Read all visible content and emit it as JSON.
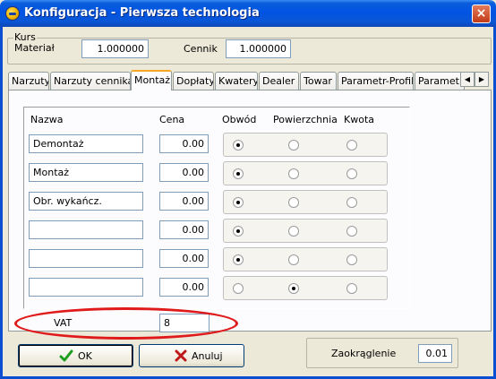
{
  "window": {
    "title": "Konfiguracja - Pierwsza technologia",
    "close_glyph": "×"
  },
  "kurs": {
    "legend": "Kurs",
    "material_label": "Materiał",
    "material_value": "1.000000",
    "cennik_label": "Cennik",
    "cennik_value": "1.000000"
  },
  "tabs": [
    {
      "label": "Narzuty"
    },
    {
      "label": "Narzuty cennika"
    },
    {
      "label": "Montaż"
    },
    {
      "label": "Dopłaty"
    },
    {
      "label": "Kwatery"
    },
    {
      "label": "Dealer"
    },
    {
      "label": "Towar"
    },
    {
      "label": "Parametr-Profile"
    },
    {
      "label": "Parametr-L"
    }
  ],
  "active_tab": "Montaż",
  "scroll": {
    "left_glyph": "◀",
    "right_glyph": "▶"
  },
  "montaz": {
    "headers": {
      "nazwa": "Nazwa",
      "cena": "Cena",
      "obwod": "Obwód",
      "powierzchnia": "Powierzchnia",
      "kwota": "Kwota"
    },
    "rows": [
      {
        "nazwa": "Demontaż",
        "cena": "0.00",
        "selected": "obwod"
      },
      {
        "nazwa": "Montaż",
        "cena": "0.00",
        "selected": "obwod"
      },
      {
        "nazwa": "Obr. wykańcz.",
        "cena": "0.00",
        "selected": "obwod"
      },
      {
        "nazwa": "",
        "cena": "0.00",
        "selected": "obwod"
      },
      {
        "nazwa": "",
        "cena": "0.00",
        "selected": "obwod"
      },
      {
        "nazwa": "",
        "cena": "0.00",
        "selected": "powierzchnia"
      }
    ],
    "vat_label": "VAT",
    "vat_value": "8"
  },
  "buttons": {
    "ok_label": "OK",
    "cancel_label": "Anuluj"
  },
  "zaokraglenie": {
    "label": "Zaokrąglenie",
    "value": "0.01"
  },
  "colors": {
    "title_bar": "#0054E3",
    "window_bg": "#ECE9D8",
    "highlight_ellipse": "#E01A1A",
    "ok_check": "#1E9E1E",
    "cancel_x": "#C01818",
    "active_tab_accent": "#F5A623"
  }
}
